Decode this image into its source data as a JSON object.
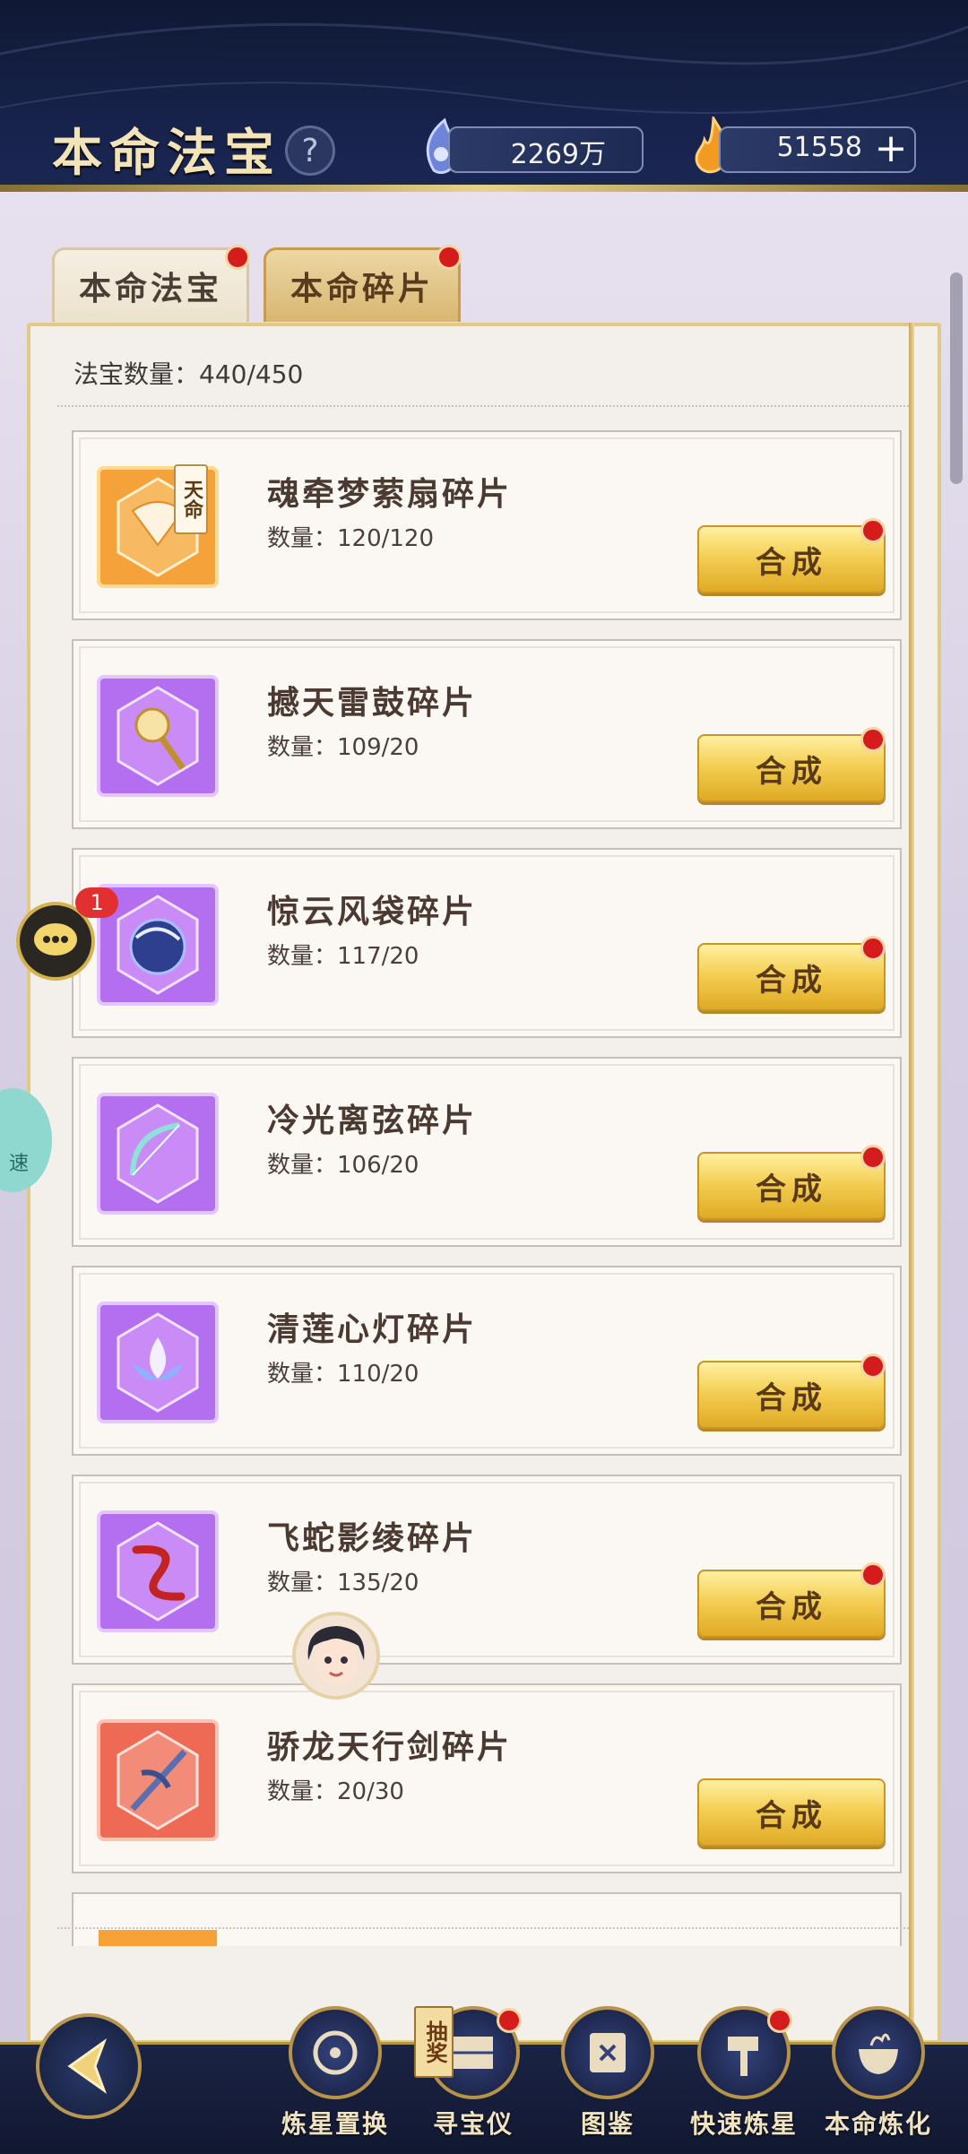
{
  "header": {
    "title": "本命法宝",
    "help_icon": "question-icon",
    "currency_1": {
      "icon": "spirit-crystal-icon",
      "value": "2269万"
    },
    "currency_2": {
      "icon": "flame-icon",
      "value": "51558"
    },
    "plus_label": "+"
  },
  "tabs": [
    {
      "label": "本命法宝",
      "has_dot": true,
      "active": false
    },
    {
      "label": "本命碎片",
      "has_dot": true,
      "active": true
    }
  ],
  "panel": {
    "count_label": "法宝数量：440/450"
  },
  "items": [
    {
      "name": "魂牵梦萦扇碎片",
      "count": "数量：120/120",
      "button": "合成",
      "has_dot": true,
      "rarity": "orange",
      "badge": "天命",
      "icon": "fan-icon"
    },
    {
      "name": "撼天雷鼓碎片",
      "count": "数量：109/20",
      "button": "合成",
      "has_dot": true,
      "rarity": "purple",
      "icon": "drum-icon"
    },
    {
      "name": "惊云风袋碎片",
      "count": "数量：117/20",
      "button": "合成",
      "has_dot": true,
      "rarity": "purple",
      "icon": "wind-bag-icon"
    },
    {
      "name": "冷光离弦碎片",
      "count": "数量：106/20",
      "button": "合成",
      "has_dot": true,
      "rarity": "purple",
      "icon": "bow-icon"
    },
    {
      "name": "清莲心灯碎片",
      "count": "数量：110/20",
      "button": "合成",
      "has_dot": true,
      "rarity": "purple",
      "icon": "lotus-lamp-icon"
    },
    {
      "name": "飞蛇影绫碎片",
      "count": "数量：135/20",
      "button": "合成",
      "has_dot": true,
      "rarity": "purple",
      "icon": "snake-ribbon-icon"
    },
    {
      "name": "骄龙天行剑碎片",
      "count": "数量：20/30",
      "button": "合成",
      "has_dot": false,
      "rarity": "red",
      "icon": "dragon-sword-icon"
    }
  ],
  "floating": {
    "chat_badge": "1",
    "speed_label": "速"
  },
  "bottom_nav": {
    "lottery_tag": "抽奖",
    "items": [
      {
        "label": "炼星置换",
        "icon": "star-swap-icon",
        "has_dot": false
      },
      {
        "label": "寻宝仪",
        "icon": "treasure-hunt-icon",
        "has_dot": true
      },
      {
        "label": "图鉴",
        "icon": "scroll-icon",
        "has_dot": false
      },
      {
        "label": "快速炼星",
        "icon": "hammer-icon",
        "has_dot": true
      },
      {
        "label": "本命炼化",
        "icon": "cauldron-icon",
        "has_dot": false
      }
    ]
  },
  "colors": {
    "accent_gold": "#e9cf92",
    "header_bg": "#17224a",
    "red_dot": "#d51c1c",
    "rarity_orange": "#f09a3a",
    "rarity_purple": "#9a3fe0",
    "rarity_red": "#e8604e"
  }
}
